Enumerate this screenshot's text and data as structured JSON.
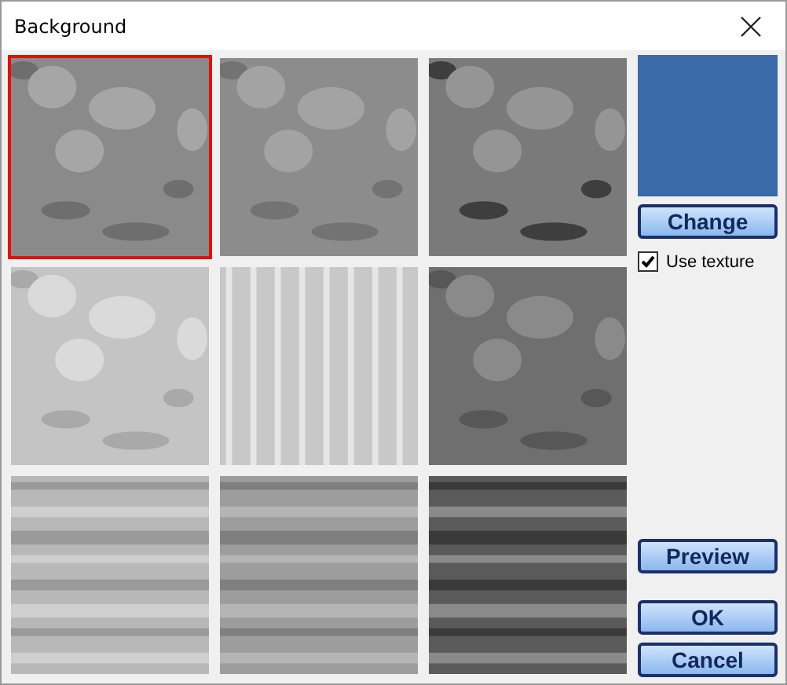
{
  "window": {
    "title": "Background"
  },
  "textures": [
    {
      "kind": "picture",
      "selected": true
    },
    {
      "kind": "picture",
      "selected": false
    },
    {
      "kind": "picture",
      "selected": false
    },
    {
      "kind": "picture",
      "selected": false
    },
    {
      "kind": "picture",
      "selected": false
    },
    {
      "kind": "picture",
      "selected": false
    },
    {
      "kind": "picture",
      "selected": false
    },
    {
      "kind": "picture",
      "selected": false
    },
    {
      "kind": "picture",
      "selected": false
    }
  ],
  "swatch": {
    "color": "#3a6aa8"
  },
  "change_button": "Change",
  "use_texture": {
    "label": "Use texture",
    "checked": true
  },
  "buttons": [
    "Preview",
    "OK",
    "Cancel"
  ]
}
